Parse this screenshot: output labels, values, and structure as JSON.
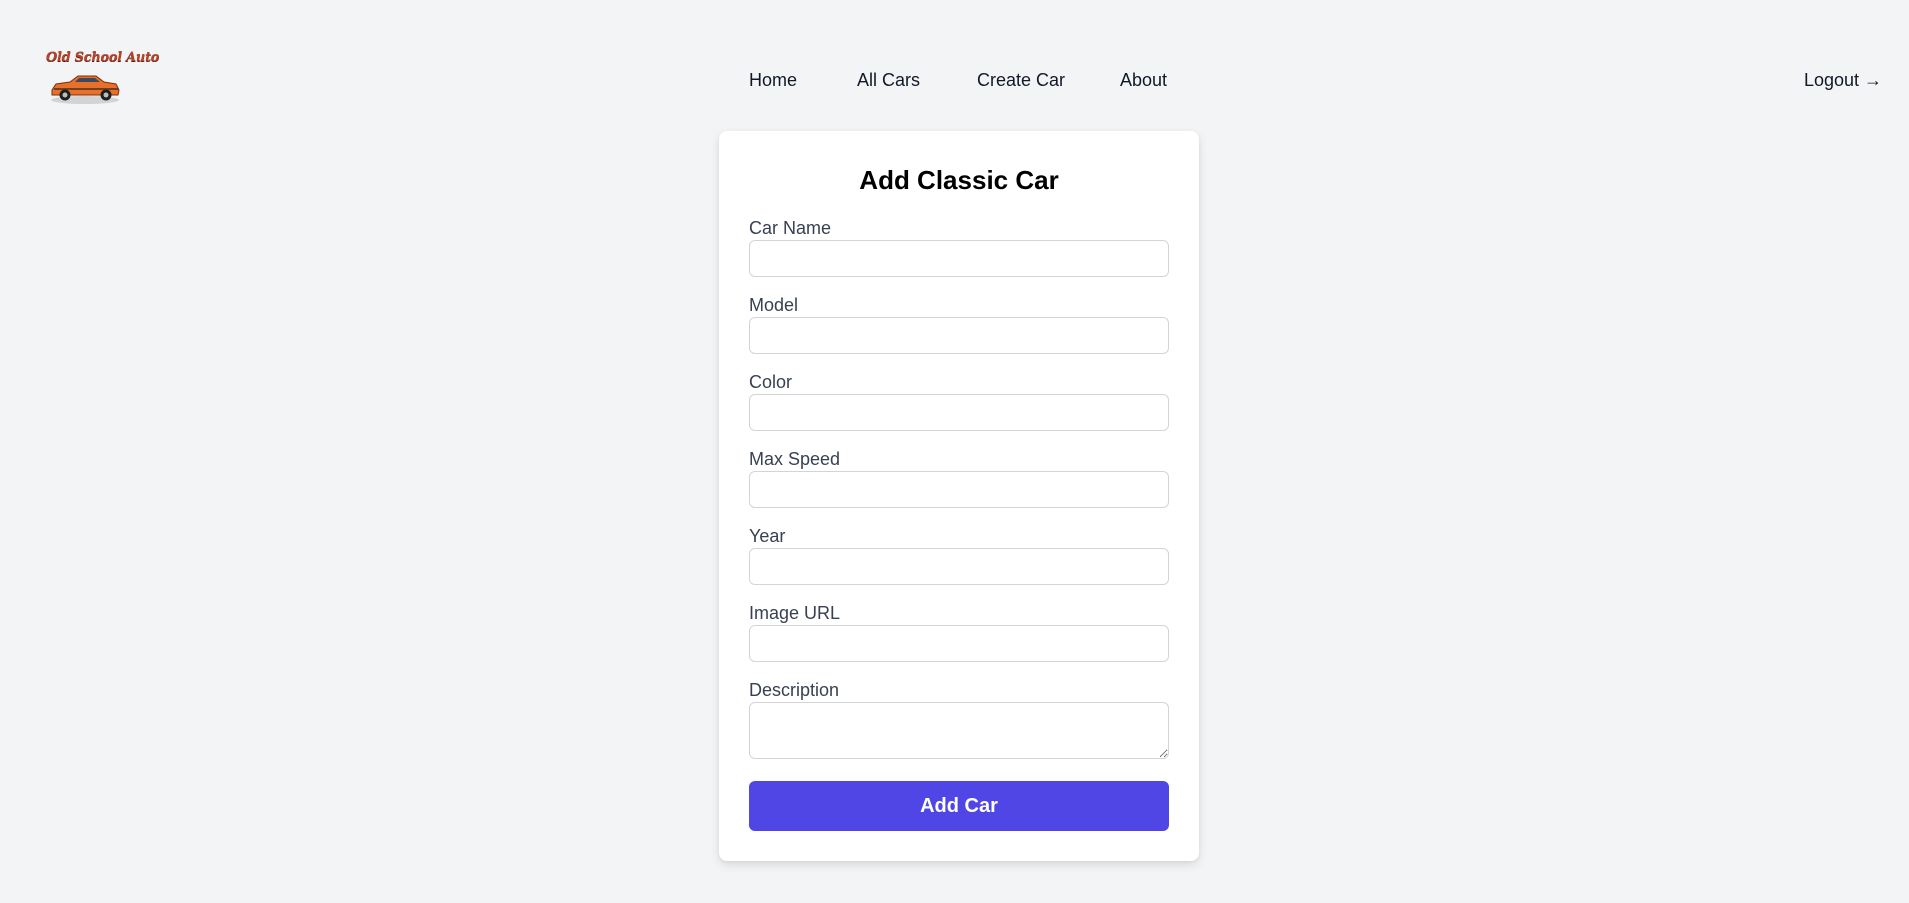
{
  "brand": {
    "logo_text": "Old School Auto",
    "car_color": "#e8702a"
  },
  "nav": {
    "home": "Home",
    "all_cars": "All Cars",
    "create_car": "Create Car",
    "about": "About"
  },
  "logout": "Logout →",
  "form": {
    "title": "Add Classic Car",
    "fields": [
      {
        "label": "Car Name",
        "value": ""
      },
      {
        "label": "Model",
        "value": ""
      },
      {
        "label": "Color",
        "value": ""
      },
      {
        "label": "Max Speed",
        "value": ""
      },
      {
        "label": "Year",
        "value": ""
      },
      {
        "label": "Image URL",
        "value": ""
      },
      {
        "label": "Description",
        "value": ""
      }
    ],
    "submit_label": "Add Car"
  },
  "colors": {
    "background": "#f3f4f6",
    "accent": "#4f46e5",
    "card": "#ffffff"
  }
}
